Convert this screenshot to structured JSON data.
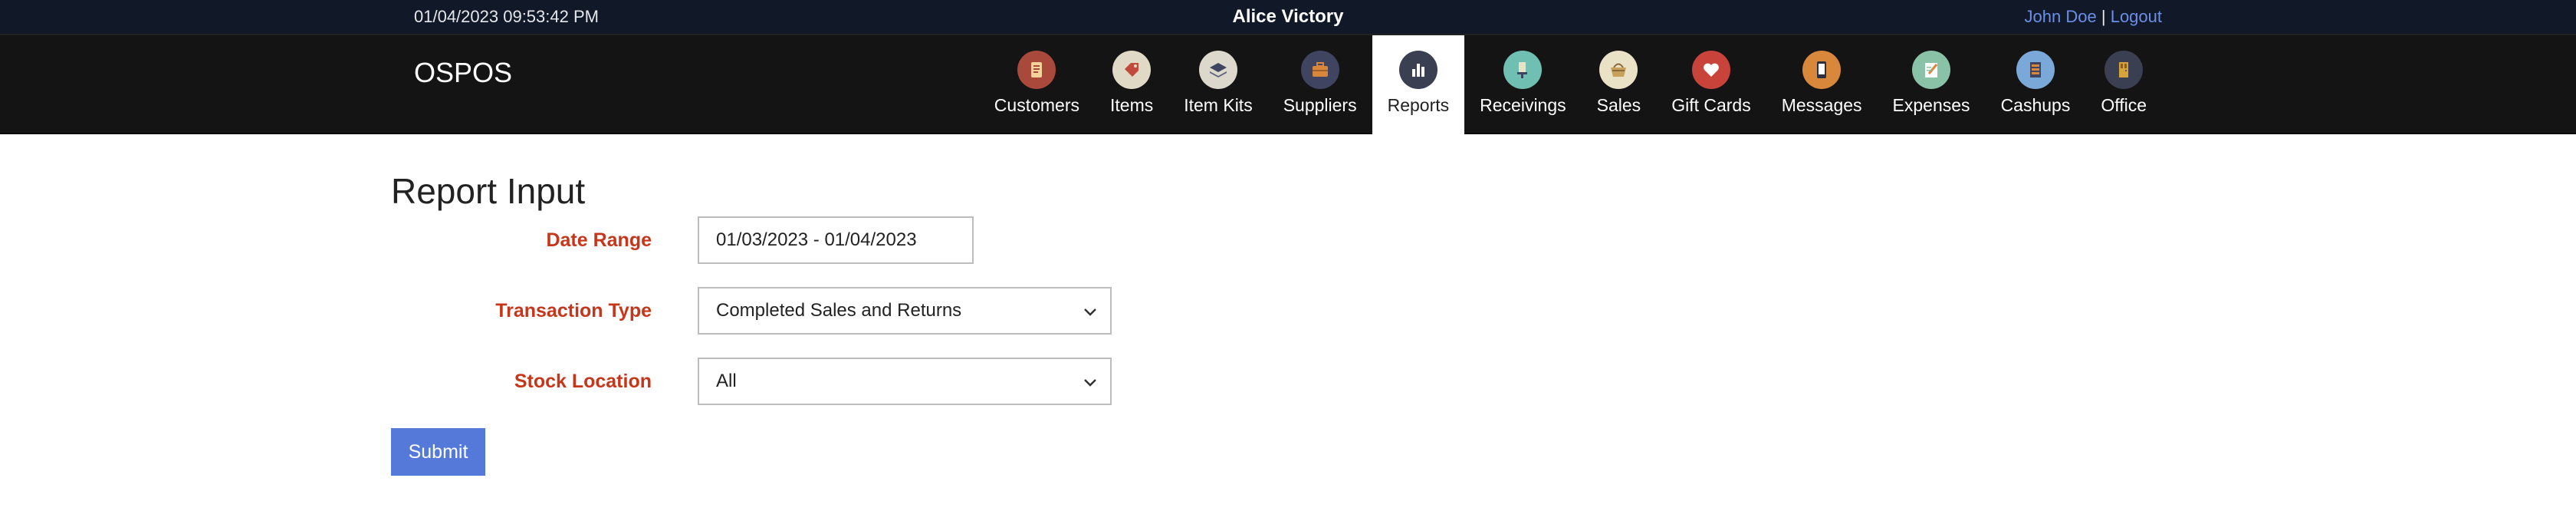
{
  "topbar": {
    "datetime": "01/04/2023 09:53:42 PM",
    "company": "Alice Victory",
    "user_name": "John Doe",
    "separator": "|",
    "logout_label": "Logout"
  },
  "navbar": {
    "brand": "OSPOS",
    "items": [
      {
        "label": "Customers",
        "icon": "customers-icon",
        "color": "#a8493b"
      },
      {
        "label": "Items",
        "icon": "tag-icon",
        "color": "#e0d9c6"
      },
      {
        "label": "Item Kits",
        "icon": "stack-icon",
        "color": "#dcd8cc"
      },
      {
        "label": "Suppliers",
        "icon": "briefcase-icon",
        "color": "#3f4560"
      },
      {
        "label": "Reports",
        "icon": "bar-chart-icon",
        "color": "#3b3f52"
      },
      {
        "label": "Receivings",
        "icon": "receiving-icon",
        "color": "#6fbfb2"
      },
      {
        "label": "Sales",
        "icon": "basket-icon",
        "color": "#e9e2c7"
      },
      {
        "label": "Gift Cards",
        "icon": "heart-icon",
        "color": "#c8433a"
      },
      {
        "label": "Messages",
        "icon": "phone-icon",
        "color": "#d8873b"
      },
      {
        "label": "Expenses",
        "icon": "notepad-icon",
        "color": "#8ac2a8"
      },
      {
        "label": "Cashups",
        "icon": "register-icon",
        "color": "#7aa8d8"
      },
      {
        "label": "Office",
        "icon": "office-door-icon",
        "color": "#3b3f52"
      }
    ],
    "active_index": 4
  },
  "form": {
    "title": "Report Input",
    "date_range": {
      "label": "Date Range",
      "value": "01/03/2023 - 01/04/2023"
    },
    "transaction_type": {
      "label": "Transaction Type",
      "value": "Completed Sales and Returns"
    },
    "stock_location": {
      "label": "Stock Location",
      "value": "All"
    },
    "submit_label": "Submit"
  },
  "colors": {
    "label_red": "#c6361b",
    "submit_blue": "#5479d8",
    "link_blue": "#6b8fe8",
    "navbar_bg": "#141414",
    "topbar_bg": "#111827"
  }
}
